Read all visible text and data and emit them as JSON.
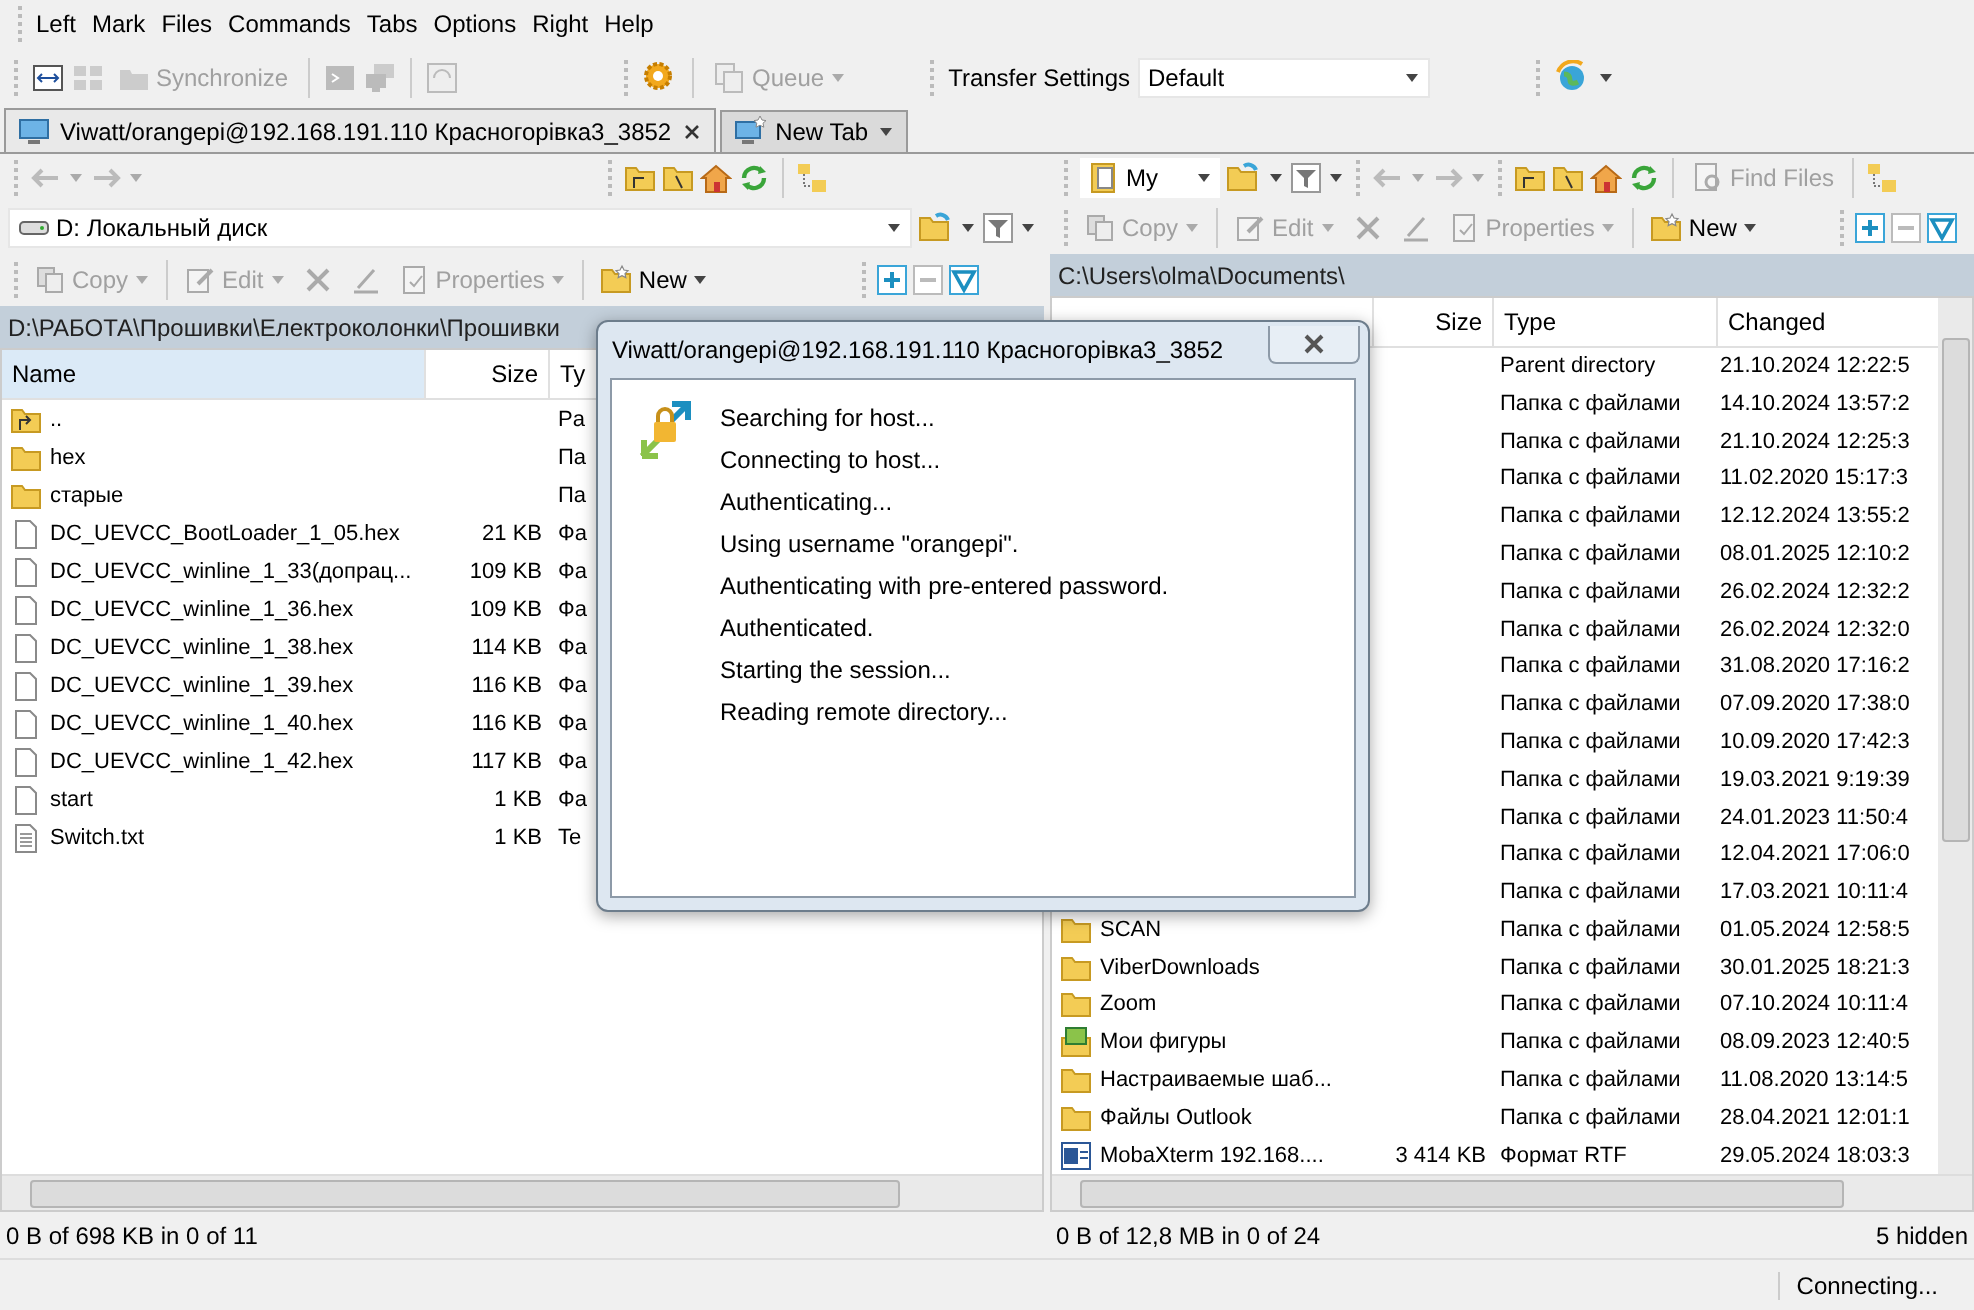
{
  "menu": [
    "Left",
    "Mark",
    "Files",
    "Commands",
    "Tabs",
    "Options",
    "Right",
    "Help"
  ],
  "toolbar": {
    "synchronize": {
      "label": "Synchronize",
      "disabled": true
    },
    "queue": {
      "label": "Queue",
      "disabled": true
    },
    "transfer_settings": {
      "label": "Transfer Settings",
      "value": "Default"
    }
  },
  "tabs": [
    {
      "label": "Viwatt/orangepi@192.168.191.110 Красногорівка3_3852",
      "selected": true,
      "kind": "session"
    },
    {
      "label": "New Tab",
      "selected": false,
      "kind": "new"
    }
  ],
  "left_panel": {
    "drive": "D: Локальный диск",
    "commands": [
      {
        "kind": "copy",
        "label": "Copy",
        "disabled": true
      },
      {
        "kind": "edit",
        "label": "Edit",
        "disabled": true
      },
      {
        "kind": "delete",
        "disabled": true
      },
      {
        "kind": "rename",
        "disabled": true
      },
      {
        "kind": "properties",
        "label": "Properties",
        "disabled": true
      },
      {
        "kind": "new",
        "label": "New",
        "disabled": false
      }
    ],
    "path": "D:\\РАБОТА\\Прошивки\\Електроколонки\\Прошивки",
    "columns": [
      "Name",
      "Size",
      "Ty"
    ],
    "rows": [
      {
        "kind": "parent",
        "name": "..",
        "type": "Pa"
      },
      {
        "kind": "folder",
        "name": "hex",
        "type": "Па"
      },
      {
        "kind": "folder",
        "name": "старые",
        "type": "Па"
      },
      {
        "kind": "file",
        "name": "DC_UEVCC_BootLoader_1_05.hex",
        "size": "21 KB",
        "type": "Фа"
      },
      {
        "kind": "file",
        "name": "DC_UEVCC_winline_1_33(допрац...",
        "size": "109 KB",
        "type": "Фа"
      },
      {
        "kind": "file",
        "name": "DC_UEVCC_winline_1_36.hex",
        "size": "109 KB",
        "type": "Фа"
      },
      {
        "kind": "file",
        "name": "DC_UEVCC_winline_1_38.hex",
        "size": "114 KB",
        "type": "Фа"
      },
      {
        "kind": "file",
        "name": "DC_UEVCC_winline_1_39.hex",
        "size": "116 KB",
        "type": "Фа"
      },
      {
        "kind": "file",
        "name": "DC_UEVCC_winline_1_40.hex",
        "size": "116 KB",
        "type": "Фа"
      },
      {
        "kind": "file",
        "name": "DC_UEVCC_winline_1_42.hex",
        "size": "117 KB",
        "type": "Фа"
      },
      {
        "kind": "file",
        "name": "start",
        "size": "1 KB",
        "type": "Фа"
      },
      {
        "kind": "text",
        "name": "Switch.txt",
        "size": "1 KB",
        "type": "Te"
      }
    ],
    "status": "0 B of 698 KB in 0 of 11"
  },
  "right_panel": {
    "location": "My",
    "find_files": {
      "label": "Find Files",
      "disabled": true
    },
    "commands": [
      {
        "kind": "copy",
        "label": "Copy",
        "disabled": true
      },
      {
        "kind": "edit",
        "label": "Edit",
        "disabled": true
      },
      {
        "kind": "delete",
        "disabled": true
      },
      {
        "kind": "rename",
        "disabled": true
      },
      {
        "kind": "properties",
        "label": "Properties",
        "disabled": true
      },
      {
        "kind": "new",
        "label": "New",
        "disabled": false
      }
    ],
    "path": "C:\\Users\\olma\\Documents\\",
    "columns": [
      "Size",
      "Type",
      "Changed"
    ],
    "rows": [
      {
        "type": "Parent directory",
        "changed": "21.10.2024 12:22:5"
      },
      {
        "type": "Папка с файлами",
        "changed": "14.10.2024 13:57:2"
      },
      {
        "type": "Папка с файлами",
        "changed": "21.10.2024 12:25:3"
      },
      {
        "type": "Папка с файлами",
        "changed": "11.02.2020 15:17:3"
      },
      {
        "type": "Папка с файлами",
        "changed": "12.12.2024 13:55:2"
      },
      {
        "type": "Папка с файлами",
        "changed": "08.01.2025 12:10:2"
      },
      {
        "type": "Папка с файлами",
        "changed": "26.02.2024 12:32:2"
      },
      {
        "type": "Папка с файлами",
        "changed": "26.02.2024 12:32:0"
      },
      {
        "type": "Папка с файлами",
        "changed": "31.08.2020 17:16:2"
      },
      {
        "type": "Папка с файлами",
        "changed": "07.09.2020 17:38:0"
      },
      {
        "type": "Папка с файлами",
        "changed": "10.09.2020 17:42:3"
      },
      {
        "type": "Папка с файлами",
        "changed": "19.03.2021 9:19:39"
      },
      {
        "type": "Папка с файлами",
        "changed": "24.01.2023 11:50:4"
      },
      {
        "type": "Папка с файлами",
        "changed": "12.04.2021 17:06:0"
      },
      {
        "type": "Папка с файлами",
        "changed": "17.03.2021 10:11:4"
      },
      {
        "kind": "folder",
        "name": "SCAN",
        "type": "Папка с файлами",
        "changed": "01.05.2024 12:58:5"
      },
      {
        "kind": "folder",
        "name": "ViberDownloads",
        "type": "Папка с файлами",
        "changed": "30.01.2025 18:21:3"
      },
      {
        "kind": "folder",
        "name": "Zoom",
        "type": "Папка с файлами",
        "changed": "07.10.2024 10:11:4"
      },
      {
        "kind": "library",
        "name": "Мои фигуры",
        "type": "Папка с файлами",
        "changed": "08.09.2023 12:40:5"
      },
      {
        "kind": "folder",
        "name": "Настраиваемые шаб...",
        "type": "Папка с файлами",
        "changed": "11.08.2020 13:14:5"
      },
      {
        "kind": "folder",
        "name": "Файлы Outlook",
        "type": "Папка с файлами",
        "changed": "28.04.2021 12:01:1"
      },
      {
        "kind": "document",
        "name": "MobaXterm 192.168....",
        "size": "3 414 KB",
        "type": "Формат RTF",
        "changed": "29.05.2024 18:03:3"
      }
    ],
    "status": "0 B of 12,8 MB in 0 of 24",
    "hidden": "5 hidden"
  },
  "dialog": {
    "title": "Viwatt/orangepi@192.168.191.110 Красногорівка3_3852",
    "messages": [
      "Searching for host...",
      "Connecting to host...",
      "Authenticating...",
      "Using username \"orangepi\".",
      "Authenticating with pre-entered password.",
      "Authenticated.",
      "Starting the session...",
      "Reading remote directory..."
    ]
  },
  "connection_status": "Connecting..."
}
